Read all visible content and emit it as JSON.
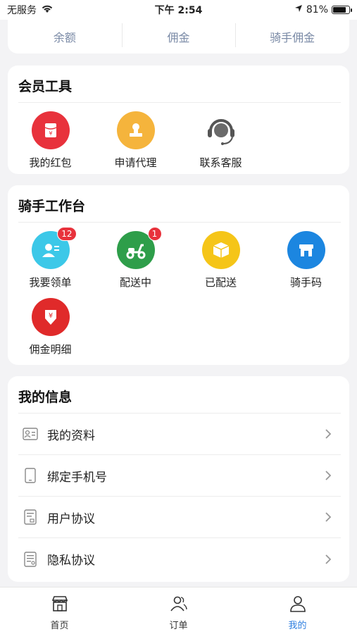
{
  "status_bar": {
    "carrier": "无服务",
    "time": "下午 2:54",
    "battery": "81%",
    "battery_level": 0.81
  },
  "top_tabs": [
    "余额",
    "佣金",
    "骑手佣金"
  ],
  "member_tools": {
    "title": "会员工具",
    "items": [
      {
        "label": "我的红包",
        "icon": "red-envelope-icon",
        "color": "#e8323c"
      },
      {
        "label": "申请代理",
        "icon": "stamp-icon",
        "color": "#f5b43c"
      },
      {
        "label": "联系客服",
        "icon": "headset-icon",
        "color": "#555555"
      }
    ]
  },
  "rider_workbench": {
    "title": "骑手工作台",
    "items": [
      {
        "label": "我要领单",
        "icon": "take-order-icon",
        "color": "#3cc8e8",
        "badge": "12"
      },
      {
        "label": "配送中",
        "icon": "scooter-icon",
        "color": "#2e9e4a",
        "badge": "1"
      },
      {
        "label": "已配送",
        "icon": "box-icon",
        "color": "#f5c518"
      },
      {
        "label": "骑手码",
        "icon": "store-icon",
        "color": "#1c86e0"
      },
      {
        "label": "佣金明细",
        "icon": "commission-icon",
        "color": "#e02a2a"
      }
    ]
  },
  "my_info": {
    "title": "我的信息",
    "rows": [
      {
        "label": "我的资料",
        "icon": "profile-card-icon"
      },
      {
        "label": "绑定手机号",
        "icon": "phone-icon"
      },
      {
        "label": "用户协议",
        "icon": "agreement-icon"
      },
      {
        "label": "隐私协议",
        "icon": "privacy-doc-icon"
      }
    ]
  },
  "tabbar": {
    "items": [
      {
        "label": "首页",
        "icon": "shop-icon"
      },
      {
        "label": "订单",
        "icon": "users-icon"
      },
      {
        "label": "我的",
        "icon": "person-icon",
        "active": true
      }
    ]
  },
  "accent_color": "#2f7fe0"
}
